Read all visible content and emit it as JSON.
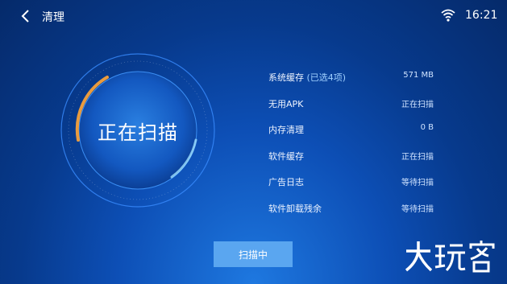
{
  "header": {
    "title": "清理",
    "time": "16:21",
    "icons": {
      "back": "chevron-left-icon",
      "wifi": "wifi-icon"
    }
  },
  "scan": {
    "status_text": "正在扫描",
    "button_label": "扫描中"
  },
  "items": [
    {
      "label": "系统缓存",
      "hint": "(已选4项)",
      "value": "571 MB"
    },
    {
      "label": "无用APK",
      "hint": "",
      "value": "正在扫描"
    },
    {
      "label": "内存清理",
      "hint": "",
      "value": "0 B"
    },
    {
      "label": "软件缓存",
      "hint": "",
      "value": "正在扫描"
    },
    {
      "label": "广告日志",
      "hint": "",
      "value": "等待扫描"
    },
    {
      "label": "软件卸载残余",
      "hint": "",
      "value": "等待扫描"
    }
  ],
  "watermark": {
    "text": "大玩客"
  },
  "colors": {
    "accent": "#5aa6f0",
    "arc": "#f5a03a",
    "ring": "#2f8bff"
  }
}
